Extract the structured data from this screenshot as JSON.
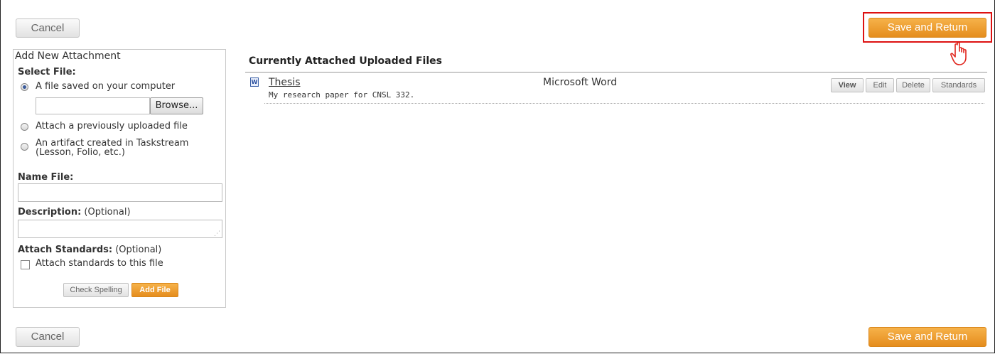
{
  "top": {
    "cancel_label": "Cancel",
    "save_return_label": "Save and Return"
  },
  "bottom": {
    "cancel_label": "Cancel",
    "save_return_label": "Save and Return"
  },
  "panel": {
    "title": "Add New Attachment",
    "select_file_label": "Select File:",
    "options": [
      {
        "label": "A file saved on your computer",
        "checked": true
      },
      {
        "label": "Attach a previously uploaded file",
        "checked": false
      },
      {
        "label": "An artifact created in Taskstream",
        "label_line2": "(Lesson, Folio, etc.)",
        "checked": false
      }
    ],
    "browse_label": "Browse...",
    "name_label": "Name File:",
    "description_label": "Description:",
    "optional_text": "(Optional)",
    "standards_label": "Attach Standards:",
    "standards_checkbox_label": "Attach standards to this file",
    "check_spelling_label": "Check Spelling",
    "add_file_label": "Add File"
  },
  "files": {
    "heading": "Currently Attached Uploaded Files",
    "items": [
      {
        "name": "Thesis",
        "description": "My research paper for CNSL 332.",
        "type": "Microsoft Word",
        "icon": "word-doc-icon",
        "actions": [
          "View",
          "Edit",
          "Delete",
          "Standards"
        ]
      }
    ]
  },
  "colors": {
    "accent_orange": "#e99724",
    "highlight_red": "#dd1111"
  }
}
